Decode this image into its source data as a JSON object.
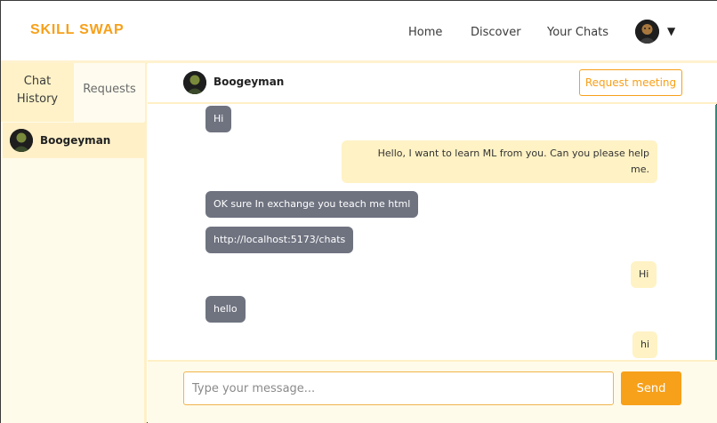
{
  "navbar": {
    "brand": "SKILL SWAP",
    "links": [
      {
        "label": "Home"
      },
      {
        "label": "Discover"
      },
      {
        "label": "Your Chats"
      }
    ],
    "caret": "▼"
  },
  "sidebar": {
    "tabs": {
      "history_line1": "Chat",
      "history_line2": "History",
      "requests": "Requests"
    },
    "contacts": [
      {
        "name": "Boogeyman"
      }
    ]
  },
  "chat": {
    "header": {
      "name": "Boogeyman",
      "request_button": "Request meeting"
    },
    "messages": [
      {
        "from": "them",
        "text": "Hi"
      },
      {
        "from": "me",
        "text_line1": "Hello, I want to learn ML from you. Can you please help",
        "text_line2": "me."
      },
      {
        "from": "them",
        "text": "OK sure In exchange you teach me html"
      },
      {
        "from": "them",
        "text": "http://localhost:5173/chats"
      },
      {
        "from": "me",
        "text": "Hi"
      },
      {
        "from": "them",
        "text": "hello"
      },
      {
        "from": "me",
        "text": "hi"
      }
    ],
    "composer": {
      "placeholder": "Type your message...",
      "send_label": "Send"
    }
  },
  "colors": {
    "accent": "#f7a01a",
    "incoming_bubble": "#6f7380",
    "outgoing_bubble": "#fff2c4",
    "sidebar_bg": "#fffbea"
  }
}
